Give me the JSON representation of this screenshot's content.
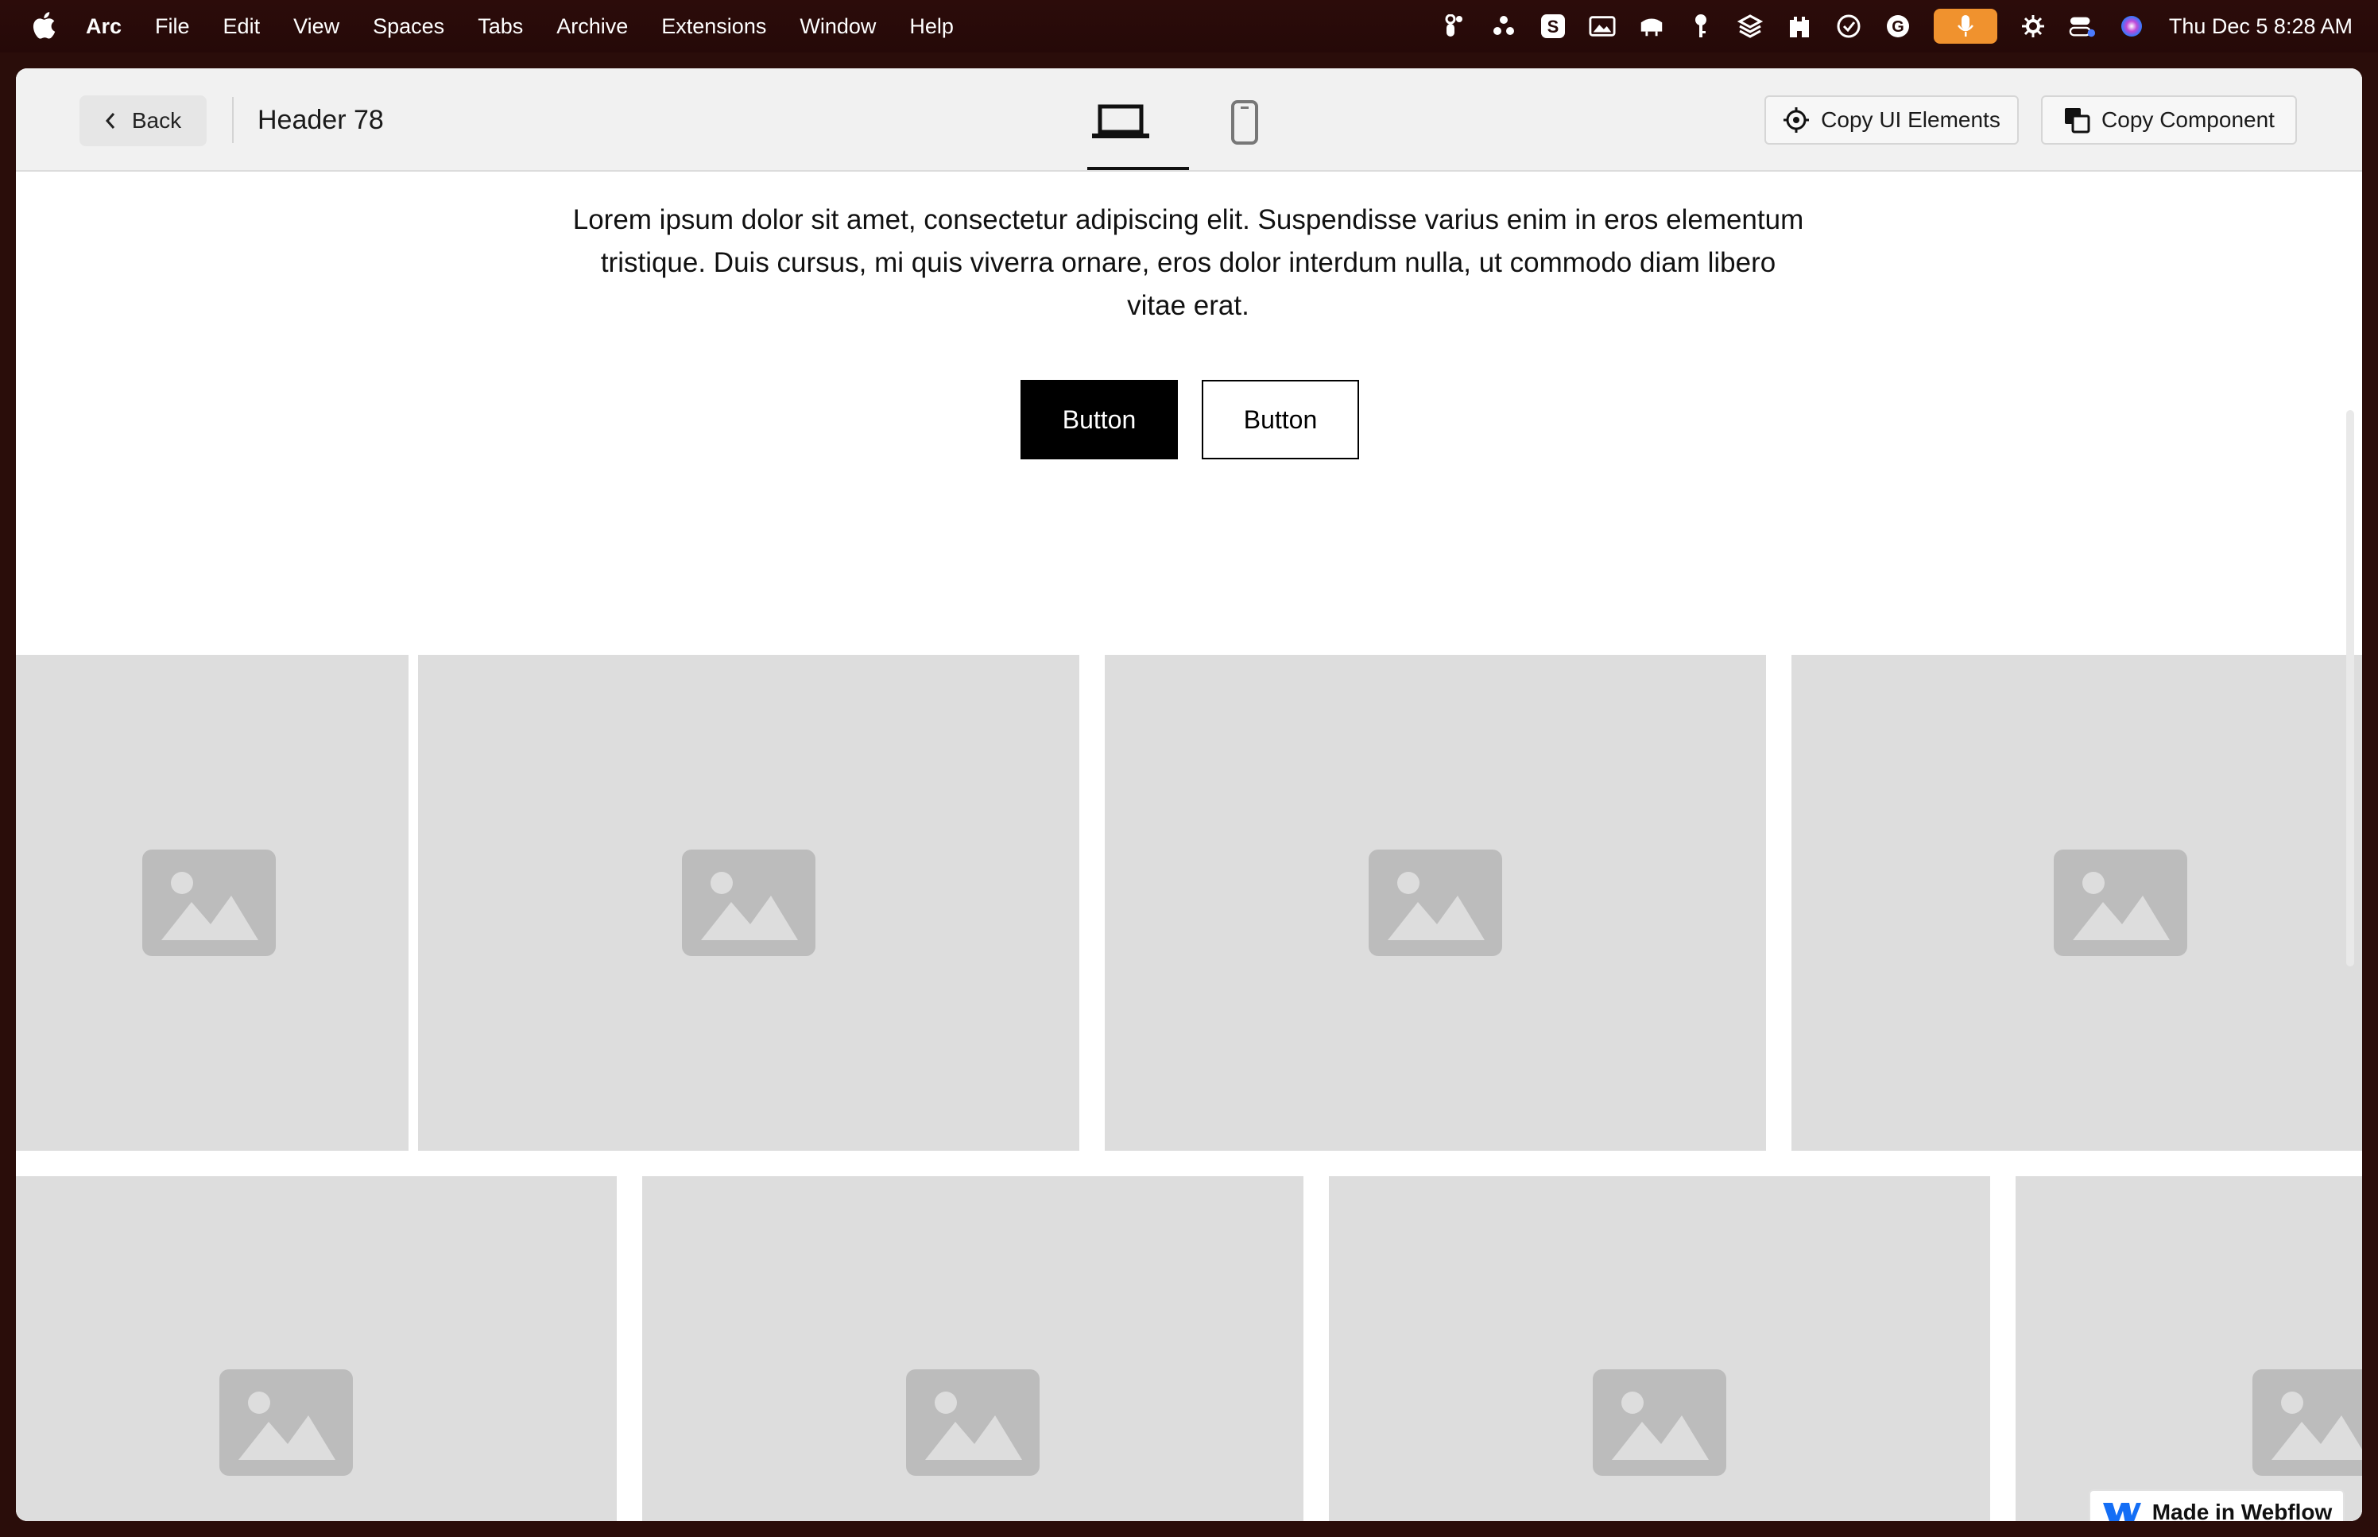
{
  "menubar": {
    "app_name": "Arc",
    "items": [
      "File",
      "Edit",
      "View",
      "Spaces",
      "Tabs",
      "Archive",
      "Extensions",
      "Window",
      "Help"
    ],
    "clock": "Thu Dec 5  8:28 AM",
    "status_icons": [
      "figma-icon",
      "people-icon",
      "s-app-icon",
      "photos-icon",
      "cloud-icon",
      "key-icon",
      "layers-icon",
      "castle-icon",
      "clock-check-icon",
      "grammarly-icon",
      "microphone-icon",
      "gear-icon",
      "control-center-icon",
      "siri-icon"
    ],
    "accent_mic": "#f0922e"
  },
  "toolbar": {
    "back_label": "Back",
    "title": "Header 78",
    "copy_ui_label": "Copy UI Elements",
    "copy_component_label": "Copy Component",
    "view_selected": "desktop"
  },
  "hero": {
    "text": "Lorem ipsum dolor sit amet, consectetur adipiscing elit. Suspendisse varius enim in eros elementum tristique. Duis cursus, mi quis viverra ornare, eros dolor interdum nulla, ut commodo diam libero vitae erat.",
    "primary_button": "Button",
    "secondary_button": "Button"
  },
  "gallery": {
    "tile_color": "#dddddd",
    "icon_color": "#bcbcbc",
    "row1_count": 4,
    "row2_count": 4
  },
  "badge": {
    "label": "Made in Webflow",
    "brand_color": "#146ef5"
  }
}
